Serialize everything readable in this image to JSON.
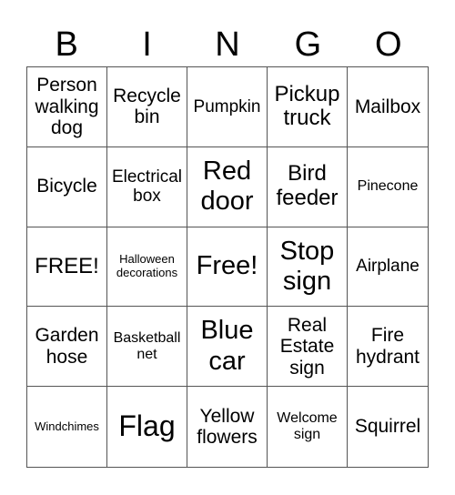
{
  "header": {
    "letters": [
      "B",
      "I",
      "N",
      "G",
      "O"
    ]
  },
  "cells": [
    "Person walking dog",
    "Recycle bin",
    "Pumpkin",
    "Pickup truck",
    "Mailbox",
    "Bicycle",
    "Electrical box",
    "Red door",
    "Bird feeder",
    "Pinecone",
    "FREE!",
    "Halloween decorations",
    "Free!",
    "Stop sign",
    "Airplane",
    "Garden hose",
    "Basketball net",
    "Blue car",
    "Real Estate sign",
    "Fire hydrant",
    "Windchimes",
    "Flag",
    "Yellow flowers",
    "Welcome sign",
    "Squirrel"
  ]
}
